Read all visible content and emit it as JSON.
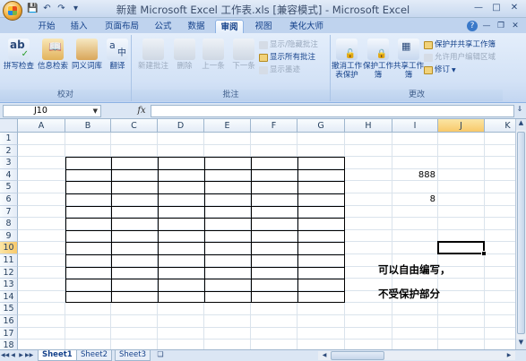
{
  "window": {
    "title": "新建 Microsoft Excel 工作表.xls  [兼容模式] - Microsoft Excel",
    "qat_icons": [
      "save-icon",
      "undo-icon",
      "redo-icon",
      "customize-icon"
    ]
  },
  "tabs": [
    "开始",
    "插入",
    "页面布局",
    "公式",
    "数据",
    "审阅",
    "视图",
    "美化大师"
  ],
  "active_tab": "审阅",
  "ribbon": {
    "proofing": {
      "label": "校对",
      "buttons": [
        "拼写检查",
        "信息检索",
        "同义词库",
        "翻译"
      ]
    },
    "comments": {
      "label": "批注",
      "buttons": [
        "新建批注",
        "删除",
        "上一条",
        "下一条"
      ],
      "small": [
        "显示/隐藏批注",
        "显示所有批注",
        "显示墨迹"
      ]
    },
    "changes": {
      "label": "更改",
      "buttons": [
        "撤消工作表保护",
        "保护工作簿",
        "共享工作簿"
      ],
      "small": [
        "保护并共享工作簿",
        "允许用户编辑区域",
        "修订"
      ]
    }
  },
  "formula_bar": {
    "name_box": "J10",
    "fx": "fx",
    "value": ""
  },
  "grid": {
    "columns": [
      "A",
      "B",
      "C",
      "D",
      "E",
      "F",
      "G",
      "H",
      "I",
      "J",
      "K"
    ],
    "rows": [
      "1",
      "2",
      "3",
      "4",
      "5",
      "6",
      "7",
      "8",
      "9",
      "10",
      "11",
      "12",
      "13",
      "14",
      "15",
      "16",
      "17",
      "18"
    ],
    "selected_cell": "J10",
    "cells": {
      "I4": "888",
      "I6": "8"
    },
    "note_line1": "可以自由编写，",
    "note_line2": "不受保护部分"
  },
  "sheets": [
    "Sheet1",
    "Sheet2",
    "Sheet3"
  ],
  "active_sheet": "Sheet1"
}
